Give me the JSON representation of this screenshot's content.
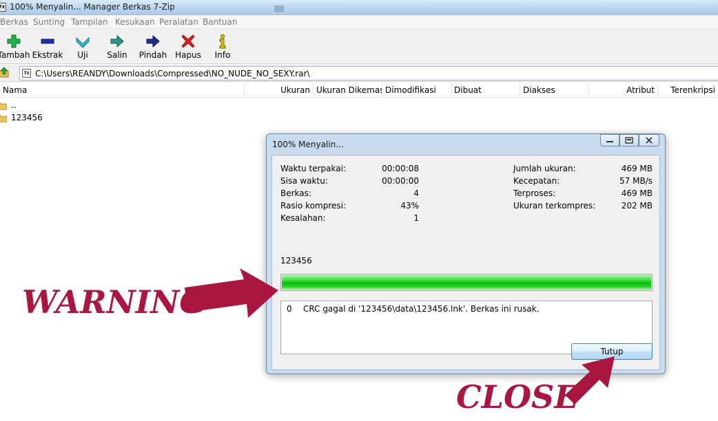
{
  "window": {
    "title": "100% Menyalin... Manager Berkas 7-Zip",
    "app_icon_text": "7z"
  },
  "menu": [
    "Berkas",
    "Sunting",
    "Tampilan",
    "Kesukaan",
    "Peralatan",
    "Bantuan"
  ],
  "toolbar": [
    {
      "label": "Tambah",
      "icon": "plus-icon",
      "color": "#22b14c"
    },
    {
      "label": "Ekstrak",
      "icon": "minus-icon",
      "color": "#1a2fa8"
    },
    {
      "label": "Uji",
      "icon": "check-chevron-icon",
      "color": "#2bbfd1"
    },
    {
      "label": "Salin",
      "icon": "copy-arrow-icon",
      "color": "#2a9a8c"
    },
    {
      "label": "Pindah",
      "icon": "move-arrow-icon",
      "color": "#1d2f8a"
    },
    {
      "label": "Hapus",
      "icon": "delete-x-icon",
      "color": "#d71d1d"
    },
    {
      "label": "Info",
      "icon": "info-icon",
      "color": "#e6c400"
    }
  ],
  "address": {
    "path": "C:\\Users\\REANDY\\Downloads\\Compressed\\NO_NUDE_NO_SEXY.rar\\",
    "file_icon_text": "7z"
  },
  "columns": [
    "Nama",
    "Ukuran",
    "Ukuran Dikemas",
    "Dimodifikasi",
    "Dibuat",
    "Diakses",
    "Atribut",
    "Terenkripsi"
  ],
  "files": [
    {
      "name": ".."
    },
    {
      "name": "123456"
    }
  ],
  "dialog": {
    "title": "100% Menyalin...",
    "stats_left": [
      {
        "label": "Waktu terpakai:",
        "value": "00:00:08"
      },
      {
        "label": "Sisa waktu:",
        "value": "00:00:00"
      },
      {
        "label": "Berkas:",
        "value": "4"
      },
      {
        "label": "Rasio kompresi:",
        "value": "43%"
      },
      {
        "label": "Kesalahan:",
        "value": "1"
      }
    ],
    "stats_right": [
      {
        "label": "Jumlah ukuran:",
        "value": "469 MB"
      },
      {
        "label": "Kecepatan:",
        "value": "57 MB/s"
      },
      {
        "label": "Terproses:",
        "value": "469 MB"
      },
      {
        "label": "Ukuran terkompres:",
        "value": "202 MB"
      }
    ],
    "current_item": "123456",
    "progress": 1.0,
    "errors": [
      {
        "num": "0",
        "message": "CRC gagal di '123456\\data\\123456.lnk'. Berkas ini rusak."
      }
    ],
    "close_label": "Tutup"
  },
  "annotations": {
    "warning": "WARNING",
    "close": "CLOSE",
    "color": "#a91640"
  }
}
